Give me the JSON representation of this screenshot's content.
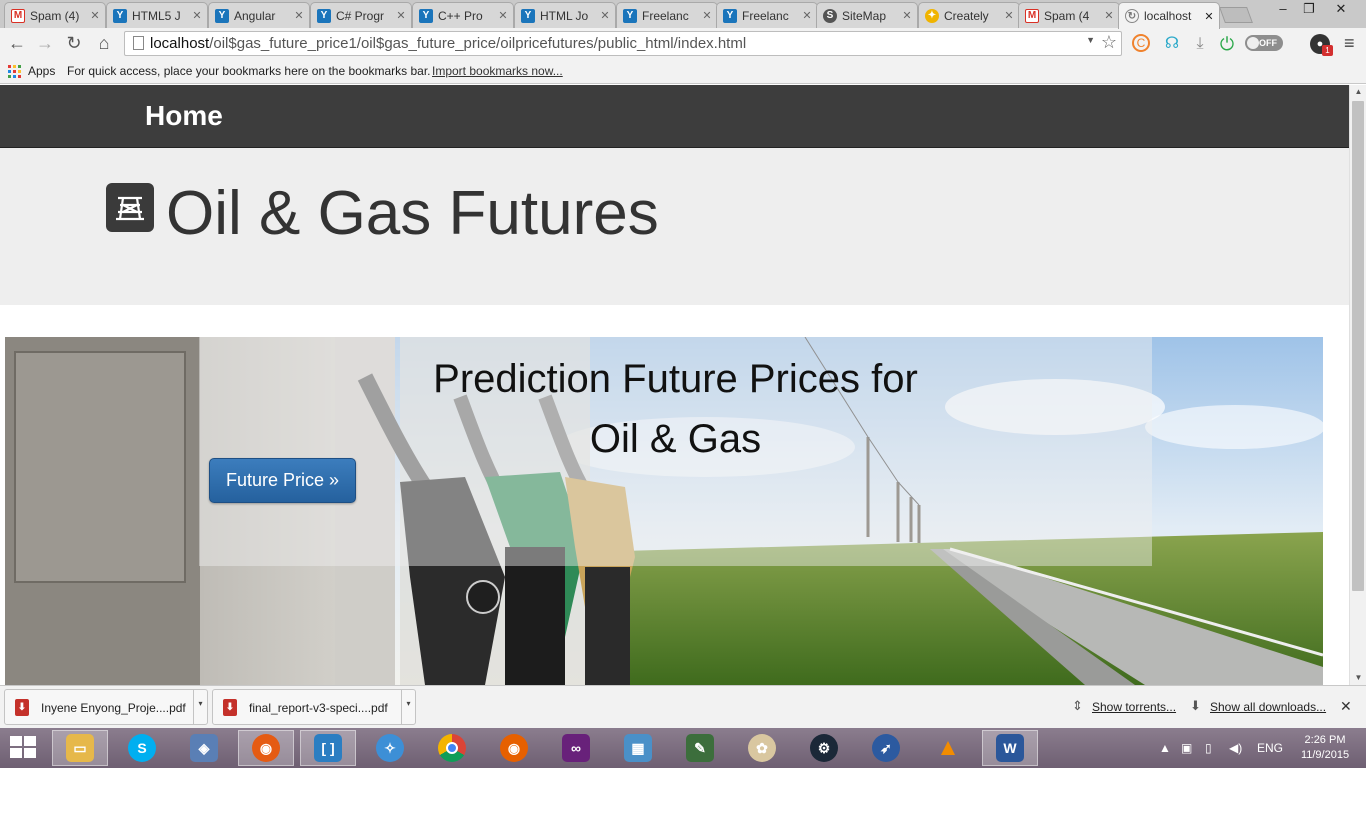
{
  "browser": {
    "tabs": [
      {
        "label": "Spam (4)",
        "favicon": "gmail-icon",
        "active": false
      },
      {
        "label": "HTML5 J",
        "favicon": "freelancer-icon",
        "active": false
      },
      {
        "label": "Angular",
        "favicon": "freelancer-icon",
        "active": false
      },
      {
        "label": "C# Progr",
        "favicon": "freelancer-icon",
        "active": false
      },
      {
        "label": "C++ Pro",
        "favicon": "freelancer-icon",
        "active": false
      },
      {
        "label": "HTML Jo",
        "favicon": "freelancer-icon",
        "active": false
      },
      {
        "label": "Freelanc",
        "favicon": "freelancer-icon",
        "active": false
      },
      {
        "label": "Freelanc",
        "favicon": "freelancer-icon",
        "active": false
      },
      {
        "label": "SiteMap",
        "favicon": "sitemap-icon",
        "active": false
      },
      {
        "label": "Creately",
        "favicon": "lightbulb-icon",
        "active": false
      },
      {
        "label": "Spam (4",
        "favicon": "gmail-icon",
        "active": false
      },
      {
        "label": "localhost",
        "favicon": "loading-icon",
        "active": true
      }
    ],
    "url_host": "localhost",
    "url_path": "/oil$gas_future_price1/oil$gas_future_price/oilpricefutures/public_html/index.html",
    "extensions": {
      "off_toggle_label": "OFF",
      "notification_badge": "1"
    },
    "bookmarks": {
      "apps_label": "Apps",
      "hint": "For quick access, place your bookmarks here on the bookmarks bar.",
      "import_link": "Import bookmarks now..."
    }
  },
  "page": {
    "nav_brand": "Home",
    "jumbotron_title": "Oil & Gas Futures",
    "hero": {
      "headline_line1": "Prediction Future Prices for",
      "headline_line2": "Oil & Gas",
      "cta_label": "Future Price »"
    }
  },
  "downloads": {
    "items": [
      {
        "name": "Inyene Enyong_Proje....pdf"
      },
      {
        "name": "final_report-v3-speci....pdf"
      }
    ],
    "show_torrents": "Show torrents...",
    "show_all": "Show all downloads..."
  },
  "taskbar": {
    "language": "ENG",
    "time": "2:26 PM",
    "date": "11/9/2015"
  },
  "colors": {
    "nav_bg": "#3d3d3d",
    "jumbotron_bg": "#eeeeee",
    "button_blue": "#2f6fae",
    "taskbar": "#7d6f80"
  }
}
